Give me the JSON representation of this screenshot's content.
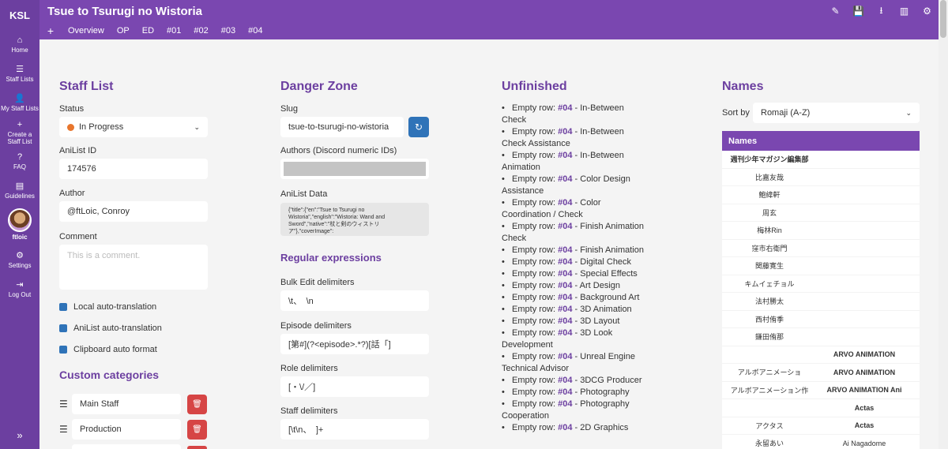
{
  "app": {
    "logo": "KSL",
    "title": "Tsue to Tsurugi no Wistoria"
  },
  "sidebar": {
    "items": [
      {
        "icon": "home-icon",
        "glyph": "⌂",
        "label": "Home"
      },
      {
        "icon": "list-icon",
        "glyph": "☰",
        "label": "Staff Lists"
      },
      {
        "icon": "user-icon",
        "glyph": "👤",
        "label": "My Staff Lists"
      },
      {
        "icon": "plus-icon",
        "glyph": "+",
        "label": "Create a Staff List"
      },
      {
        "icon": "question-icon",
        "glyph": "?",
        "label": "FAQ"
      },
      {
        "icon": "book-icon",
        "glyph": "▤",
        "label": "Guidelines"
      }
    ],
    "username": "ftloic",
    "bottom_items": [
      {
        "icon": "settings-icon",
        "glyph": "⚙",
        "label": "Settings"
      },
      {
        "icon": "logout-icon",
        "glyph": "⇥",
        "label": "Log Out"
      }
    ],
    "expand_glyph": "»"
  },
  "topbar": {
    "tabs": [
      "Overview",
      "OP",
      "ED",
      "#01",
      "#02",
      "#03",
      "#04"
    ],
    "add_glyph": "+",
    "tools": [
      {
        "name": "edit-icon",
        "glyph": "✎"
      },
      {
        "name": "save-icon",
        "glyph": "💾"
      },
      {
        "name": "download-icon",
        "glyph": "⭳"
      },
      {
        "name": "stats-icon",
        "glyph": "▥"
      },
      {
        "name": "gear-icon",
        "glyph": "⚙"
      }
    ]
  },
  "staff_list": {
    "heading": "Staff List",
    "status_label": "Status",
    "status_value": "In Progress",
    "anilist_id_label": "AniList ID",
    "anilist_id_value": "174576",
    "author_label": "Author",
    "author_value": "@ftLoic, Conroy",
    "comment_label": "Comment",
    "comment_placeholder": "This is a comment.",
    "checks": [
      "Local auto-translation",
      "AniList auto-translation",
      "Clipboard auto format"
    ],
    "custom_heading": "Custom categories",
    "categories": [
      "Main Staff",
      "Production"
    ]
  },
  "danger": {
    "heading": "Danger Zone",
    "slug_label": "Slug",
    "slug_value": "tsue-to-tsurugi-no-wistoria",
    "authors_label": "Authors (Discord numeric IDs)",
    "anilist_data_label": "AniList Data",
    "anilist_data_value": "{\"title\":{\"en\":\"Tsue to Tsurugi no Wistoria\",\"english\":\"Wistoria: Wand and Sword\",\"native\":\"杖と剣のウィストリア\"},\"coverImage\":",
    "regex_heading": "Regular expressions",
    "bulk_label": "Bulk Edit delimiters",
    "bulk_value": "\\t、　\\n",
    "episode_label": "Episode delimiters",
    "episode_value": "[第#](?<episode>.*?)[話「]",
    "role_label": "Role delimiters",
    "role_value": "[・\\/／]",
    "staff_label": "Staff delimiters",
    "staff_value": "[\\t\\n、　]+"
  },
  "unfinished": {
    "heading": "Unfinished",
    "prefix": "Empty row:",
    "episode": "#04",
    "items": [
      "In-Between Check",
      "In-Between Check Assistance",
      "In-Between Animation",
      "Color Design Assistance",
      "Color Coordination / Check",
      "Finish Animation Check",
      "Finish Animation",
      "Digital Check",
      "Special Effects",
      "Art Design",
      "Background Art",
      "3D Animation",
      "3D Layout",
      "3D Look Development",
      "Unreal Engine Technical Advisor",
      "3DCG Producer",
      "Photography",
      "Photography Cooperation",
      "2D Graphics"
    ]
  },
  "names": {
    "heading": "Names",
    "sort_label": "Sort by",
    "sort_value": "Romaji (A-Z)",
    "table_header": "Names",
    "rows": [
      [
        "週刊少年マガジン編集部",
        ""
      ],
      [
        "比嘉友哉",
        ""
      ],
      [
        "鮑緯軒",
        ""
      ],
      [
        "周玄",
        ""
      ],
      [
        "梅林Rin",
        ""
      ],
      [
        "窪市右衛門",
        ""
      ],
      [
        "関藤寛生",
        ""
      ],
      [
        "キムイェチョル",
        ""
      ],
      [
        "法村勝太",
        ""
      ],
      [
        "西村侑季",
        ""
      ],
      [
        "鎌田侑那",
        ""
      ],
      [
        "",
        "ARVO ANIMATION"
      ],
      [
        "アルボアニメーショ",
        "ARVO ANIMATION"
      ],
      [
        "アルボアニメーション作",
        "ARVO ANIMATION Ani"
      ],
      [
        "",
        "Actas"
      ],
      [
        "アクタス",
        "Actas"
      ],
      [
        "永留あい",
        "Ai Nagadome"
      ]
    ]
  }
}
